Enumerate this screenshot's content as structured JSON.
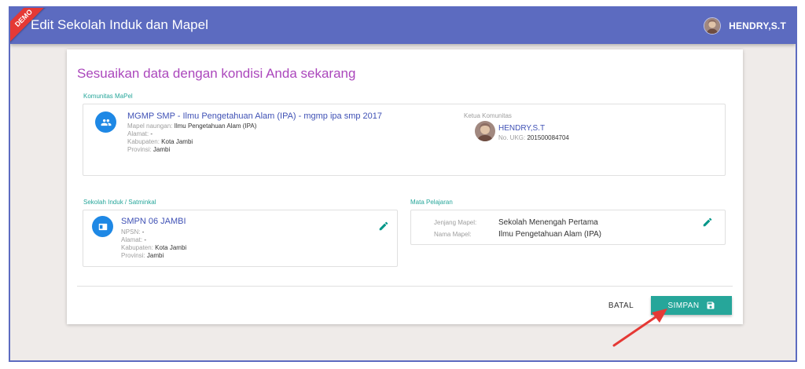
{
  "appbar": {
    "title": "Edit Sekolah Induk dan Mapel",
    "user_name": "HENDRY,S.T",
    "ribbon": "DEMO"
  },
  "card": {
    "headline": "Sesuaikan data dengan kondisi Anda sekarang"
  },
  "komunitas": {
    "section_label": "Komunitas MaPel",
    "title": "MGMP SMP - Ilmu Pengetahuan Alam (IPA) - mgmp ipa smp 2017",
    "fields": [
      {
        "key": "Mapel naungan:",
        "value": "Ilmu Pengetahuan Alam (IPA)"
      },
      {
        "key": "Alamat:",
        "value": "-"
      },
      {
        "key": "Kabupaten:",
        "value": "Kota Jambi"
      },
      {
        "key": "Provinsi:",
        "value": "Jambi"
      }
    ],
    "ketua": {
      "label": "Ketua Komunitas",
      "name": "HENDRY,S.T",
      "ukg_key": "No. UKG:",
      "ukg_value": "201500084704"
    }
  },
  "sekolah": {
    "section_label": "Sekolah Induk / Satminkal",
    "title": "SMPN 06 JAMBI",
    "fields": [
      {
        "key": "NPSN:",
        "value": "-"
      },
      {
        "key": "Alamat:",
        "value": "-"
      },
      {
        "key": "Kabupaten:",
        "value": "Kota Jambi"
      },
      {
        "key": "Provinsi:",
        "value": "Jambi"
      }
    ]
  },
  "mapel": {
    "section_label": "Mata Pelajaran",
    "fields": [
      {
        "key": "Jenjang Mapel:",
        "value": "Sekolah Menengah Pertama"
      },
      {
        "key": "Nama Mapel:",
        "value": "Ilmu Pengetahuan Alam (IPA)"
      }
    ]
  },
  "actions": {
    "cancel_label": "BATAL",
    "save_label": "SIMPAN"
  },
  "colors": {
    "appbar": "#5c6bc0",
    "headline": "#ab47bc",
    "accent": "#26a69a",
    "link": "#3f51b5",
    "icon_bg": "#1e88e5",
    "ribbon": "#e53935",
    "annotation_arrow": "#e53935"
  },
  "icons": {
    "komunitas": "group-icon",
    "sekolah": "school-card-icon",
    "edit": "pencil-icon",
    "save": "floppy-disk-icon"
  }
}
